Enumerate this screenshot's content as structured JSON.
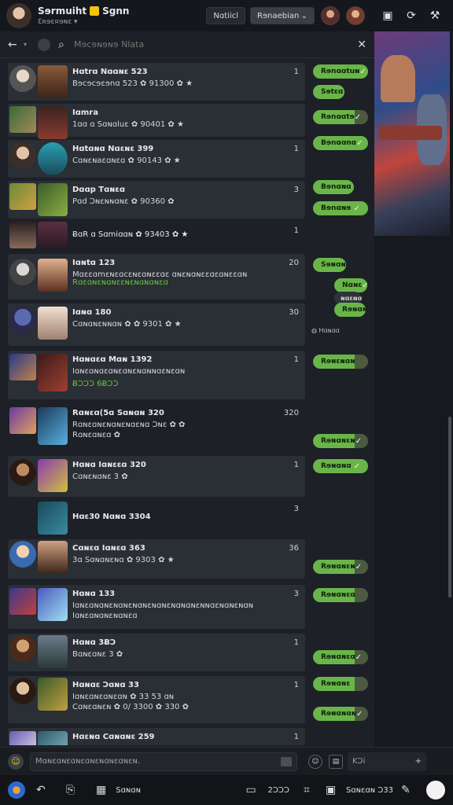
{
  "header": {
    "title": "Sɘrmuiht",
    "title_suffix": "Sgnn",
    "subtitle": "Ɛʀɘɛ¤ɘɴɛ ▾",
    "btn_1": "Nɑtiicl",
    "select_label": "Rɘnaebian",
    "icons": [
      "window-icon",
      "refresh-icon",
      "tools-icon"
    ]
  },
  "search": {
    "placeholder": "Mɘcɘɴɘɴɘ Nlata"
  },
  "rows": [
    {
      "name": "Hɑtrɑ  Nɑɑɴɛ 523",
      "line": "Bɘcɘcɘɛɘnɑ 523  ✿ 91300 ✿ ★",
      "count": "1"
    },
    {
      "name": "Iɑmra",
      "line": "1ɑɑ ɑ  Sɑɴɑluɛ  ✿ 90401 ✿ ★",
      "count": ""
    },
    {
      "name": "Hɑtɑɴɑ  Nɑɛɴɛ 399",
      "line": "Cɑɴɛɴaɛɑɴɛɑ  ✿ 90143 ✿ ★",
      "count": "1"
    },
    {
      "name": "Dɑɑp  Tɑɴɛɑ",
      "line": "Pɑd  Ɔɴɛɴɴɑɴɛ  ✿ 90360 ✿",
      "count": "3"
    },
    {
      "name": "ɃɑR ɑ  Sɑmiɑɑɴ  ✿ 93403 ✿ ★",
      "line": "",
      "count": "1"
    },
    {
      "name": "Iɑɴtɑ  123",
      "line": "Mɑɛɛɑmɛɴɛɑcɛɴɛɑɴɛɛɑɛ  ɑɴɛɴɑɴɛɛɑɛɑɴɛɛɑɴ",
      "line2": "Rɑɛɑɴɛɴɑɴɛɛɴɛɴɑɴɑɴɛɑ",
      "count": "20"
    },
    {
      "name": "Iɑɴɑ  180",
      "line": "Cɑɴɑɴɛɴɴɑɴ  ✿ ✿ 9301 ✿ ★",
      "count": "30"
    },
    {
      "name": "Hɑɴɑɛɑ  Mɑɴ 1392",
      "line": "Iɑɴɛɑɴɑɛɑɴɛɑɴɛɴɑɴɴɑɛɴɛɑɴ",
      "line2": "ɃƆƆƆ 6ɃƆƆ",
      "count": "1"
    },
    {
      "name": "Rɑɴɛɑ(5ɑ  Sɑɴɑɴ 320",
      "line": "Rɑɴɛɑɴɛɴɑɴɛɴɑɛɴɑ  Ɔɴɛ  ✿ ✿",
      "line3": "Rɑɴɛɑɴɛɑ  ✿",
      "count": "320"
    },
    {
      "name": "Hɑɴɑ  Iɑɴɛɛɑ 320",
      "line": "Cɑɴɛɴɑɴɛ 3 ✿",
      "count": "1"
    },
    {
      "name": "Hɑɛ30  Nɑɴɑ 3304",
      "line": "",
      "count": "3"
    },
    {
      "name": "Cɑɴɛɑ  Iɑɴɛɑ 363",
      "line": "3ɑ  Sɑɴɑɴɛɴɑ  ✿ 9303 ✿ ★",
      "count": "36"
    },
    {
      "name": "Hɑɴɑ  133",
      "line": "Iɑɴɛɑɴɑɴɛɴɑɴɛɴɑɴɛɴɑɴɛɴɑɴɑɴɛɴɴɑɛɴɑɴɛɴɑɴ",
      "line3": "Iɑɴɛɑɴɑɴɛɴɑɴɛɑ",
      "count": "3"
    },
    {
      "name": "Hɑɴɑ  3ɃƆ",
      "line": "Bɑɴɛɑɴɛ 3 ✿",
      "count": "1"
    },
    {
      "name": "Hɑɴɑɛ  Ɔɑɴɑ 33",
      "line": "Iɑɴɛɑɴɛɑɴɛɑɴ  ✿ 33 53 ɑɴ",
      "line3": "Cɑɴɛɑɴɛɴ  ✿ 0/ 3300 ✿ 330 ✿",
      "count": "1"
    },
    {
      "name": "Hɑɛɴɑ  Cɑɴɑɴɛ 259",
      "line": "",
      "count": "1"
    }
  ],
  "actions": [
    {
      "label": "Rɘnɑɑtuɴ",
      "check": "✓"
    },
    {
      "label": "Sɘtɛɑ",
      "check": ""
    },
    {
      "label": "Rɘnɑɑtɘ",
      "check": "✓"
    },
    {
      "label": "Bɘnɑɑnɑ",
      "check": "✓"
    },
    {
      "label": "Bɘnɑɴɑ",
      "check": ""
    },
    {
      "label": "Bɘnɑɴɘ",
      "check": "✓"
    },
    {
      "label": "Sɘɴɑɴ",
      "check": ""
    },
    {
      "label": "Nɑɴɛ",
      "check": "✓"
    },
    {
      "label": "Rɘɴɑɴ",
      "check": ""
    },
    {
      "label": "Rɘɴɛɴɑɴ",
      "check": ""
    },
    {
      "label": "Rɘɴɑɴɛɴ",
      "check": "✓"
    },
    {
      "label": "Rɘɴɑɴɑ",
      "check": "✓"
    },
    {
      "label": "Rɘɴɑɴɛɴ",
      "check": "✓"
    },
    {
      "label": "Rɘɴɑɴɛɑ",
      "check": ""
    },
    {
      "label": "Rɘɴɑɴɛɑ",
      "check": "✓"
    },
    {
      "label": "Rɘɴɑɴɛ",
      "check": ""
    },
    {
      "label": "Rɘɴɑɴɑɴ",
      "check": "✓"
    }
  ],
  "misc": {
    "small_msg": "Hɑɴɑɑ",
    "tiny_bubble": "ɴɑɛɴɑ"
  },
  "compose": {
    "placeholder": "Mɑɴɛɑɴɛɑɴɛɑɴɛɴɑɴɛɑɴɛɴ.",
    "lang_label": "KƆi"
  },
  "bottom": {
    "label_1": "Sɑɴɑɴ",
    "label_2": "2ƆƆƆ",
    "label_3": "Sɑɴɛɑɴ Ɔ33"
  },
  "colors": {
    "accent": "#6ab54a",
    "bg": "#1d2026",
    "row": "#2a2e35"
  }
}
